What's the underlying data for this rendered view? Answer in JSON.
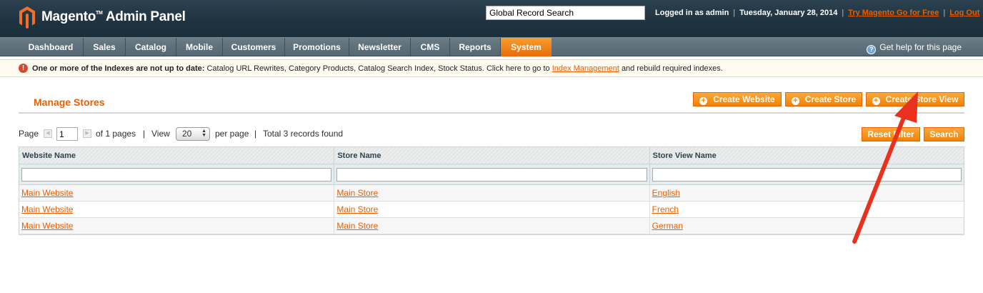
{
  "header": {
    "brand": "Magento",
    "brand_tm": "TM",
    "brand_suffix": "Admin Panel",
    "search_value": "Global Record Search",
    "logged_in": "Logged in as admin",
    "date": "Tuesday, January 28, 2014",
    "try_link": "Try Magento Go for Free",
    "logout": "Log Out",
    "sep": "|"
  },
  "nav": {
    "items": [
      {
        "label": "Dashboard"
      },
      {
        "label": "Sales"
      },
      {
        "label": "Catalog"
      },
      {
        "label": "Mobile"
      },
      {
        "label": "Customers"
      },
      {
        "label": "Promotions"
      },
      {
        "label": "Newsletter"
      },
      {
        "label": "CMS"
      },
      {
        "label": "Reports"
      },
      {
        "label": "System"
      }
    ],
    "help": "Get help for this page"
  },
  "notice": {
    "bold": "One or more of the Indexes are not up to date:",
    "text": "Catalog URL Rewrites, Category Products, Catalog Search Index, Stock Status. Click here to go to",
    "link": "Index Management",
    "tail": "and rebuild required indexes."
  },
  "page": {
    "title": "Manage Stores",
    "buttons": {
      "create_website": "Create Website",
      "create_store": "Create Store",
      "create_store_view": "Create Store View",
      "reset_filter": "Reset Filter",
      "search": "Search"
    }
  },
  "pager": {
    "page_label": "Page",
    "page_value": "1",
    "of_pages": "of 1 pages",
    "sep": "|",
    "view_label": "View",
    "per_page_value": "20",
    "per_page_label": "per page",
    "total": "Total 3 records found"
  },
  "grid": {
    "columns": [
      "Website Name",
      "Store Name",
      "Store View Name"
    ],
    "rows": [
      {
        "website": "Main Website",
        "store": "Main Store",
        "view": "English"
      },
      {
        "website": "Main Website",
        "store": "Main Store",
        "view": "French"
      },
      {
        "website": "Main Website",
        "store": "Main Store",
        "view": "German"
      }
    ]
  },
  "colors": {
    "accent": "#eb5e00",
    "header_bg": "#1f3340",
    "nav_bg": "#546772",
    "annotation_arrow": "#e8321d"
  }
}
